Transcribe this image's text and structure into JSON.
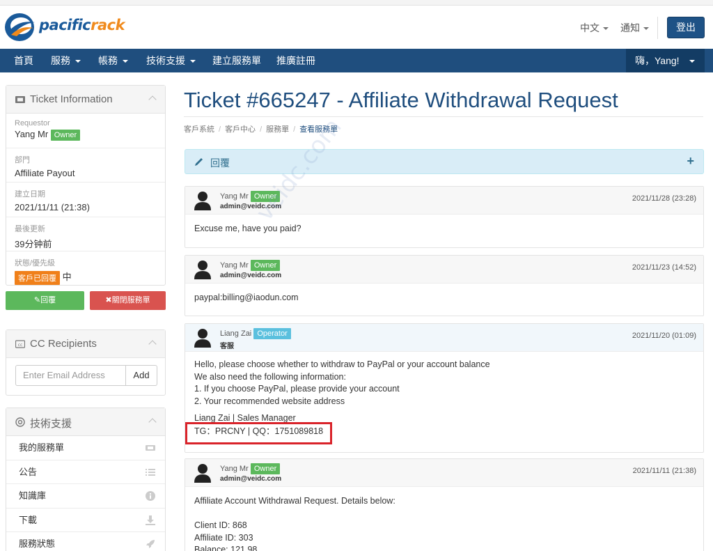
{
  "header": {
    "logo_part1": "pacific",
    "logo_part2": "rack",
    "language": "中文",
    "notifications": "通知",
    "logout": "登出"
  },
  "nav": {
    "items": [
      {
        "label": "首頁",
        "dropdown": false
      },
      {
        "label": "服務",
        "dropdown": true
      },
      {
        "label": "帳務",
        "dropdown": true
      },
      {
        "label": "技術支援",
        "dropdown": true
      },
      {
        "label": "建立服務單",
        "dropdown": false
      },
      {
        "label": "推廣註冊",
        "dropdown": false
      }
    ],
    "user_greeting": "嗨，Yang!"
  },
  "ticket_info": {
    "title": "Ticket Information",
    "fields": [
      {
        "label": "Requestor",
        "value": "Yang Mr",
        "badge": "Owner"
      },
      {
        "label": "部門",
        "value": "Affiliate Payout"
      },
      {
        "label": "建立日期",
        "value": "2021/11/11 (21:38)"
      },
      {
        "label": "最後更新",
        "value": "39分钟前"
      },
      {
        "label": "狀態/優先級",
        "status": "客戶已回覆",
        "priority": "中"
      }
    ],
    "reply_button": "回覆",
    "close_button": "關閉服務單"
  },
  "cc": {
    "title": "CC Recipients",
    "placeholder": "Enter Email Address",
    "add": "Add"
  },
  "support": {
    "title": "技術支援",
    "items": [
      {
        "label": "我的服務單",
        "icon": "ticket-icon"
      },
      {
        "label": "公告",
        "icon": "list-icon"
      },
      {
        "label": "知識庫",
        "icon": "info-icon"
      },
      {
        "label": "下載",
        "icon": "download-icon"
      },
      {
        "label": "服務狀態",
        "icon": "rocket-icon"
      }
    ]
  },
  "main": {
    "title": "Ticket #665247 - Affiliate Withdrawal Request",
    "breadcrumb": [
      "客戶系統",
      "客戶中心",
      "服務單",
      "查看服務單"
    ],
    "reply_bar": "回覆",
    "messages": [
      {
        "name": "Yang Mr",
        "badge": "Owner",
        "email": "admin@veidc.com",
        "date": "2021/11/28 (23:28)",
        "body": [
          "Excuse me, have you paid?"
        ]
      },
      {
        "name": "Yang Mr",
        "badge": "Owner",
        "email": "admin@veidc.com",
        "date": "2021/11/23 (14:52)",
        "body": [
          "paypal:billing@iaodun.com"
        ]
      },
      {
        "name": "Liang Zai",
        "badge": "Operator",
        "email": "客服",
        "date": "2021/11/20 (01:09)",
        "body": [
          "Hello, please choose whether to withdraw to PayPal or your account balance",
          "We also need the following information:",
          "1. If you choose PayPal, please provide your account",
          "2. Your recommended website address",
          "",
          "Liang Zai | Sales Manager",
          "TG：PRCNY | QQ：1751089818"
        ]
      },
      {
        "name": "Yang Mr",
        "badge": "Owner",
        "email": "admin@veidc.com",
        "date": "2021/11/11 (21:38)",
        "body": [
          "Affiliate Account Withdrawal Request. Details below:",
          "",
          "Client ID: 868",
          "Affiliate ID: 303",
          "Balance: 121.98"
        ]
      }
    ]
  },
  "watermark": "veidc.com",
  "colors": {
    "brand": "#1f4e7e",
    "owner": "#5cb85c",
    "operator": "#5bc0de",
    "status": "#f0801a",
    "highlight": "#d9232a"
  }
}
